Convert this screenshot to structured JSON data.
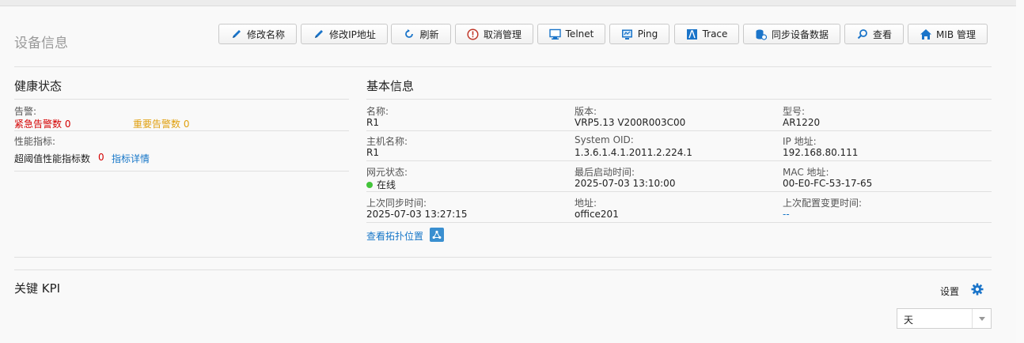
{
  "page_title": "设备信息",
  "toolbar": {
    "rename": "修改名称",
    "modify_ip": "修改IP地址",
    "refresh": "刷新",
    "cancel_manage": "取消管理",
    "telnet": "Telnet",
    "ping": "Ping",
    "trace": "Trace",
    "sync_data": "同步设备数据",
    "view": "查看",
    "mib_manage": "MIB 管理"
  },
  "health": {
    "title": "健康状态",
    "alarm_label": "告警:",
    "critical_label": "紧急告警数",
    "critical_count": "0",
    "major_label": "重要告警数",
    "major_count": "0",
    "perf_label": "性能指标:",
    "threshold_label": "超阈值性能指标数",
    "threshold_count": "0",
    "perf_detail_link": "指标详情"
  },
  "basic": {
    "title": "基本信息",
    "name_label": "名称:",
    "name": "R1",
    "version_label": "版本:",
    "version": "VRP5.13 V200R003C00",
    "model_label": "型号:",
    "model": "AR1220",
    "hostname_label": "主机名称:",
    "hostname": "R1",
    "oid_label": "System OID:",
    "oid": "1.3.6.1.4.1.2011.2.224.1",
    "ip_label": "IP 地址:",
    "ip": "192.168.80.111",
    "status_label": "网元状态:",
    "status": "在线",
    "boot_label": "最后启动时间:",
    "boot_time": "2025-07-03 13:10:00",
    "mac_label": "MAC 地址:",
    "mac": "00-E0-FC-53-17-65",
    "sync_label": "上次同步时间:",
    "sync_time": "2025-07-03 13:27:15",
    "addr_label": "地址:",
    "address": "office201",
    "cfg_label": "上次配置变更时间:",
    "cfg_time": "--",
    "topo_link": "查看拓扑位置"
  },
  "kpi": {
    "title": "关键 KPI",
    "settings": "设置",
    "period_value": "天"
  },
  "colors": {
    "critical": "#d40000",
    "major": "#e0a010",
    "link": "#1676c8",
    "online": "#43c43a",
    "icon_blue": "#1a74c9"
  }
}
